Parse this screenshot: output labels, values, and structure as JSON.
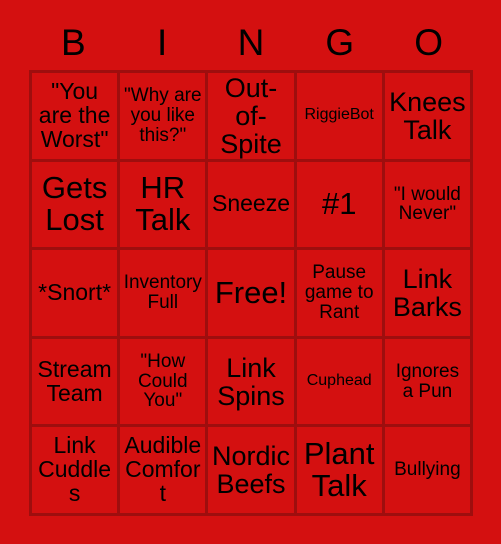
{
  "card": {
    "title_letters": [
      "B",
      "I",
      "N",
      "G",
      "O"
    ],
    "background_color": "#d41010",
    "border_color": "#9e0e0e",
    "text_color": "#000000",
    "rows": 5,
    "columns": 5,
    "cells": [
      {
        "text": "\"You are the Worst\"",
        "size": "lg",
        "free": false
      },
      {
        "text": "\"Why are you like this?\"",
        "size": "md",
        "free": false
      },
      {
        "text": "Out-of-Spite",
        "size": "xl",
        "free": false
      },
      {
        "text": "RiggieBot",
        "size": "sm",
        "free": false
      },
      {
        "text": "Knees Talk",
        "size": "xl",
        "free": false
      },
      {
        "text": "Gets Lost",
        "size": "xxl",
        "free": false
      },
      {
        "text": "HR Talk",
        "size": "xxl",
        "free": false
      },
      {
        "text": "Sneeze",
        "size": "lg",
        "free": false
      },
      {
        "text": "#1",
        "size": "xxl",
        "free": false
      },
      {
        "text": "\"I would Never\"",
        "size": "md",
        "free": false
      },
      {
        "text": "*Snort*",
        "size": "lg",
        "free": false
      },
      {
        "text": "Inventory Full",
        "size": "md",
        "free": false
      },
      {
        "text": "Free!",
        "size": "xxl",
        "free": true
      },
      {
        "text": "Pause game to Rant",
        "size": "md",
        "free": false
      },
      {
        "text": "Link Barks",
        "size": "xl",
        "free": false
      },
      {
        "text": "Stream Team",
        "size": "lg",
        "free": false
      },
      {
        "text": "\"How Could You\"",
        "size": "md",
        "free": false
      },
      {
        "text": "Link Spins",
        "size": "xl",
        "free": false
      },
      {
        "text": "Cuphead",
        "size": "sm",
        "free": false
      },
      {
        "text": "Ignores a Pun",
        "size": "md",
        "free": false
      },
      {
        "text": "Link Cuddles",
        "size": "lg",
        "free": false
      },
      {
        "text": "Audible Comfort",
        "size": "lg",
        "free": false
      },
      {
        "text": "Nordic Beefs",
        "size": "xl",
        "free": false
      },
      {
        "text": "Plant Talk",
        "size": "xxl",
        "free": false
      },
      {
        "text": "Bullying",
        "size": "md",
        "free": false
      }
    ]
  }
}
